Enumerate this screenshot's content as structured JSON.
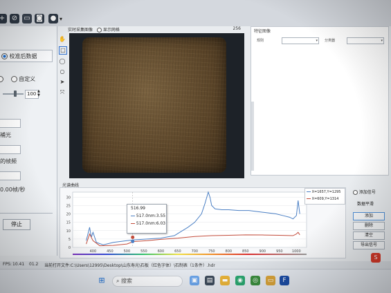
{
  "left_panel": {
    "mode_label": "校准后数据",
    "custom_label": "自定义",
    "slider_value": "100",
    "fill_light_label": "補光",
    "frame_label": "的帧频",
    "rate_label": "0.00帧/秒",
    "stop_button": "停止"
  },
  "camera_panel": {
    "title": "实时采集图像",
    "show_grid_label": "显示网格",
    "counter": "256"
  },
  "spectral_panel": {
    "title": "特征图像",
    "band_label": "规则",
    "classifier_label": "分类器"
  },
  "curve_panel": {
    "title": "光谱曲线",
    "legend": [
      "X=1657,Y=1295",
      "X=609,Y=1314"
    ],
    "tooltip": {
      "x": "516.99",
      "rows": [
        "517.0nm:3.55",
        "517.0nm:6.03"
      ]
    },
    "buttons": {
      "add_signal_label": "添加信号",
      "smooth_label": "数据平滑",
      "add": "添加",
      "delete": "删除",
      "clear": "清空",
      "export": "导出信号"
    }
  },
  "chart_data": {
    "type": "line",
    "xlim": [
      340,
      1030
    ],
    "ylim": [
      0,
      33
    ],
    "x_ticks": [
      400,
      450,
      500,
      550,
      600,
      650,
      700,
      750,
      800,
      850,
      900,
      950,
      1000
    ],
    "y_ticks": [
      0,
      5,
      10,
      15,
      20,
      25,
      30
    ],
    "series": [
      {
        "name": "X=1657,Y=1295",
        "color": "#4a7fc4",
        "x": [
          380,
          390,
          395,
          400,
          410,
          430,
          460,
          500,
          520,
          560,
          600,
          640,
          660,
          680,
          700,
          720,
          730,
          740,
          745,
          750,
          760,
          780,
          800,
          830,
          860,
          900,
          940,
          960,
          980,
          990,
          1000,
          1005,
          1010
        ],
        "y": [
          4,
          12,
          6,
          9,
          3,
          1.5,
          3,
          4,
          4.5,
          5,
          5.5,
          7,
          9.5,
          12,
          15,
          20,
          26,
          33,
          30,
          25,
          23,
          22.5,
          22.5,
          22,
          22,
          21,
          20,
          19,
          18,
          17,
          19,
          28,
          20
        ]
      },
      {
        "name": "X=609,Y=1314",
        "color": "#c24b3a",
        "x": [
          380,
          390,
          400,
          420,
          460,
          500,
          520,
          560,
          600,
          650,
          700,
          750,
          800,
          850,
          900,
          950,
          990,
          1000,
          1005,
          1010
        ],
        "y": [
          2,
          8,
          4,
          1,
          1.2,
          2,
          3.5,
          4,
          4.8,
          5.5,
          6.5,
          7,
          7.2,
          7.5,
          7.4,
          7.2,
          7.0,
          8,
          9,
          7.5
        ]
      }
    ]
  },
  "status_bar": {
    "fps": "10.41",
    "exposure": "01.2",
    "path": "当前打开文件:C:\\Users\\12995\\Desktop\\山东寿光\\石板（红色字体）\\石制表（1条件）.hdr"
  },
  "taskbar": {
    "search_placeholder": "搜索"
  }
}
